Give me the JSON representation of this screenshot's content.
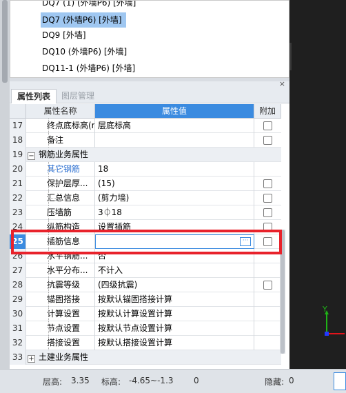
{
  "tree": {
    "items": [
      "DQ7 (1)  (外墙P6)  [外墙]",
      "DQ7 (外墙P6)  [外墙]",
      "DQ9 [外墙]",
      "DQ10 (外墙P6)  [外墙]",
      "DQ11-1 (外墙P6)  [外墙]"
    ],
    "selected_index": 1
  },
  "panel": {
    "close_glyph": "×",
    "tabs": [
      "属性列表",
      "图层管理"
    ],
    "active_tab": "属性列表"
  },
  "grid": {
    "headers": {
      "name": "属性名称",
      "value": "属性值",
      "add": "附加"
    },
    "rows": [
      {
        "num": "17",
        "name": "终点底标高(m)",
        "value": "层底标高",
        "checkbox": true
      },
      {
        "num": "18",
        "name": "备注",
        "value": "",
        "checkbox": true
      },
      {
        "num": "19",
        "name": "钢筋业务属性",
        "group": true,
        "expander": "−"
      },
      {
        "num": "20",
        "name": "其它钢筋",
        "value": "18",
        "checkbox": false,
        "blue": true
      },
      {
        "num": "21",
        "name": "保护层厚...",
        "value": "(15)",
        "checkbox": true
      },
      {
        "num": "22",
        "name": "汇总信息",
        "value": "(剪力墙)",
        "checkbox": true
      },
      {
        "num": "23",
        "name": "压墙筋",
        "value": "3⏀18",
        "checkbox": true
      },
      {
        "num": "24",
        "name": "纵筋构造",
        "value": "设置插筋",
        "checkbox": true
      },
      {
        "num": "25",
        "name": "插筋信息",
        "value": "",
        "checkbox": true,
        "editing": true
      },
      {
        "num": "26",
        "name": "水平钢筋...",
        "value": "否",
        "checkbox": false
      },
      {
        "num": "27",
        "name": "水平分布...",
        "value": "不计入",
        "checkbox": false
      },
      {
        "num": "28",
        "name": "抗震等级",
        "value": "(四级抗震)",
        "checkbox": true
      },
      {
        "num": "29",
        "name": "锚固搭接",
        "value": "按默认锚固搭接计算",
        "checkbox": false
      },
      {
        "num": "30",
        "name": "计算设置",
        "value": "按默认计算设置计算",
        "checkbox": false
      },
      {
        "num": "31",
        "name": "节点设置",
        "value": "按默认节点设置计算",
        "checkbox": false
      },
      {
        "num": "32",
        "name": "搭接设置",
        "value": "按默认搭接设置计算",
        "checkbox": false
      },
      {
        "num": "33",
        "name": "土建业务属性",
        "group": true,
        "expander": "+"
      }
    ],
    "ellipsis": "···"
  },
  "status": {
    "floor_height_label": "层高:",
    "floor_height": "3.35",
    "elevation_label": "标高:",
    "elevation": "-4.65~-1.3",
    "count": "0",
    "hidden_label": "隐藏:",
    "hidden": "0"
  },
  "axis": {
    "y_label": "Y"
  },
  "colors": {
    "accent": "#3b8be0",
    "selected": "#9fc7f1",
    "highlight": "#e8222b",
    "axis_green": "#1fb317",
    "axis_red": "#e3141b",
    "axis_blue": "#2238ff"
  }
}
